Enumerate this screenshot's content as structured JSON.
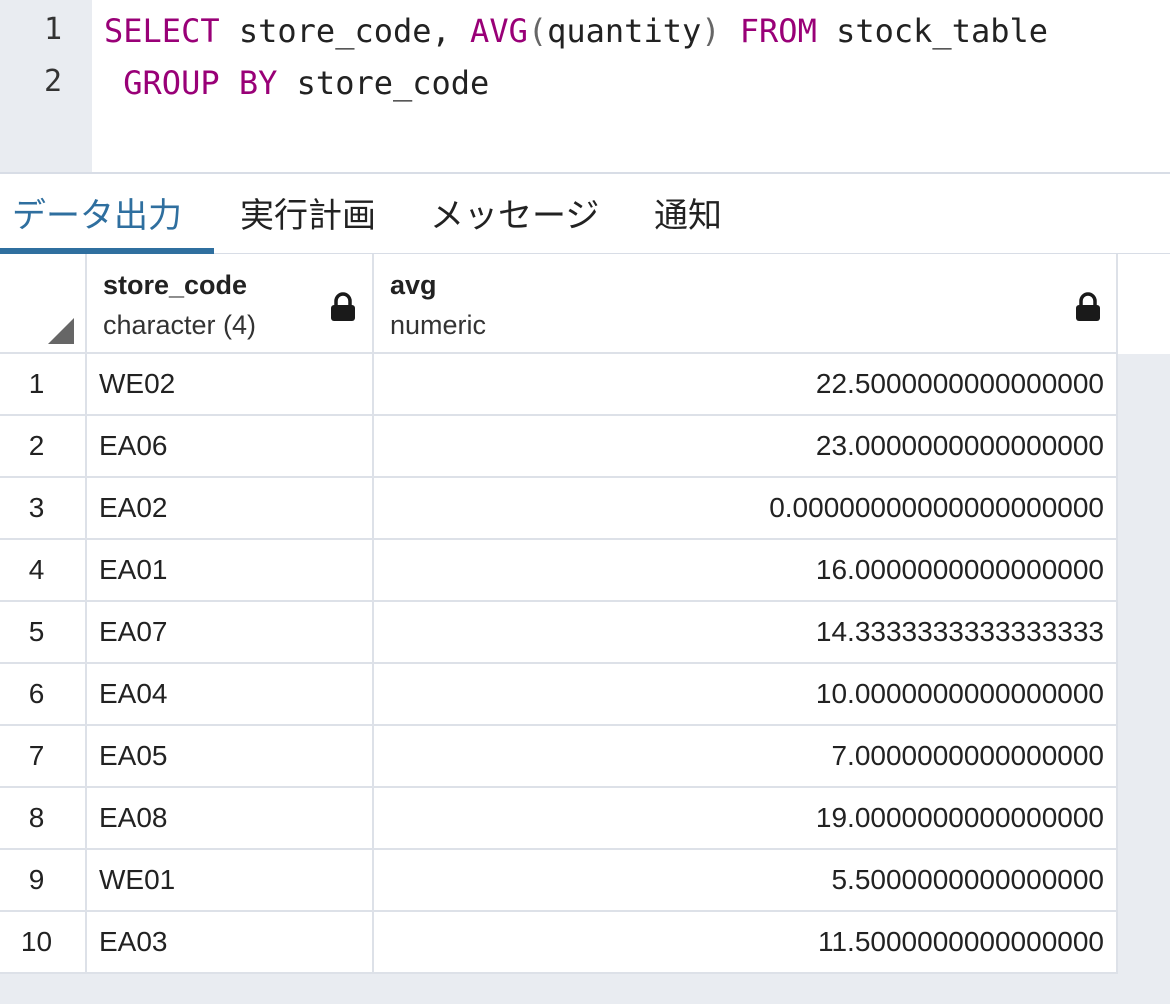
{
  "editor": {
    "line_numbers": [
      "1",
      "2"
    ],
    "line1": {
      "kw_select": "SELECT",
      "t1": " store_code, ",
      "fn_avg": "AVG",
      "p_open": "(",
      "t2": "quantity",
      "p_close": ")",
      "t3": " ",
      "kw_from": "FROM",
      "t4": " stock_table"
    },
    "line2": {
      "lead": " ",
      "kw_group": "GROUP",
      "t1": " ",
      "kw_by": "BY",
      "t2": " store_code"
    }
  },
  "tabs": [
    {
      "label": "データ出力",
      "active": true
    },
    {
      "label": "実行計画",
      "active": false
    },
    {
      "label": "メッセージ",
      "active": false
    },
    {
      "label": "通知",
      "active": false
    }
  ],
  "grid": {
    "columns": [
      {
        "name": "store_code",
        "type": "character (4)",
        "icon": "lock-icon"
      },
      {
        "name": "avg",
        "type": "numeric",
        "icon": "lock-icon"
      }
    ],
    "rows": [
      {
        "num": "1",
        "store_code": "WE02",
        "avg": "22.5000000000000000"
      },
      {
        "num": "2",
        "store_code": "EA06",
        "avg": "23.0000000000000000"
      },
      {
        "num": "3",
        "store_code": "EA02",
        "avg": "0.00000000000000000000"
      },
      {
        "num": "4",
        "store_code": "EA01",
        "avg": "16.0000000000000000"
      },
      {
        "num": "5",
        "store_code": "EA07",
        "avg": "14.3333333333333333"
      },
      {
        "num": "6",
        "store_code": "EA04",
        "avg": "10.0000000000000000"
      },
      {
        "num": "7",
        "store_code": "EA05",
        "avg": "7.0000000000000000"
      },
      {
        "num": "8",
        "store_code": "EA08",
        "avg": "19.0000000000000000"
      },
      {
        "num": "9",
        "store_code": "WE01",
        "avg": "5.5000000000000000"
      },
      {
        "num": "10",
        "store_code": "EA03",
        "avg": "11.5000000000000000"
      }
    ]
  },
  "colors": {
    "keyword": "#990077",
    "active_tab": "#2f6f9f"
  }
}
